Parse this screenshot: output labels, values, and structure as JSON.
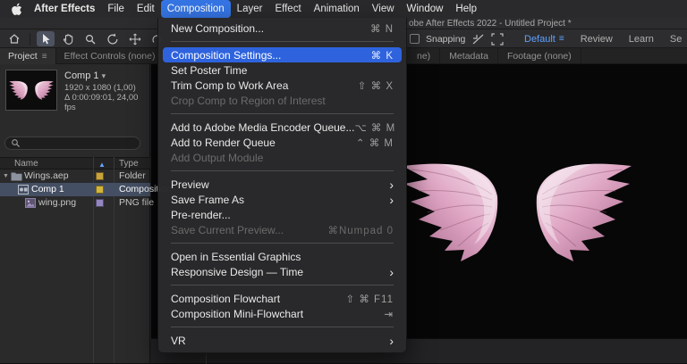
{
  "menubar": {
    "items": [
      {
        "label": "After Effects",
        "bold": true
      },
      {
        "label": "File"
      },
      {
        "label": "Edit"
      },
      {
        "label": "Composition",
        "active": true
      },
      {
        "label": "Layer"
      },
      {
        "label": "Effect"
      },
      {
        "label": "Animation"
      },
      {
        "label": "View"
      },
      {
        "label": "Window"
      },
      {
        "label": "Help"
      }
    ]
  },
  "titlebar": {
    "title": "obe After Effects 2022 - Untitled Project *"
  },
  "toolbar": {
    "snapping_label": "Snapping",
    "workspaces": [
      {
        "label": "Default",
        "active": true
      },
      {
        "label": "Review"
      },
      {
        "label": "Learn"
      },
      {
        "label": "Se"
      }
    ]
  },
  "composition_menu": {
    "items": [
      {
        "label": "New Composition...",
        "shortcut": "⌘ N"
      },
      {
        "type": "sep"
      },
      {
        "label": "Composition Settings...",
        "shortcut": "⌘ K",
        "state": "highlight"
      },
      {
        "label": "Set Poster Time"
      },
      {
        "label": "Trim Comp to Work Area",
        "shortcut": "⇧ ⌘ X"
      },
      {
        "label": "Crop Comp to Region of Interest",
        "state": "disabled"
      },
      {
        "type": "sep"
      },
      {
        "label": "Add to Adobe Media Encoder Queue...",
        "shortcut": "⌥ ⌘ M"
      },
      {
        "label": "Add to Render Queue",
        "shortcut": "⌃ ⌘ M"
      },
      {
        "label": "Add Output Module",
        "state": "disabled"
      },
      {
        "type": "sep"
      },
      {
        "label": "Preview",
        "submenu": true
      },
      {
        "label": "Save Frame As",
        "submenu": true
      },
      {
        "label": "Pre-render..."
      },
      {
        "label": "Save Current Preview...",
        "shortcut": "⌘Numpad 0",
        "state": "disabled"
      },
      {
        "type": "sep"
      },
      {
        "label": "Open in Essential Graphics"
      },
      {
        "label": "Responsive Design — Time",
        "submenu": true
      },
      {
        "type": "sep"
      },
      {
        "label": "Composition Flowchart",
        "shortcut": "⇧ ⌘ F11"
      },
      {
        "label": "Composition Mini-Flowchart",
        "shortcut": "⇥"
      },
      {
        "type": "sep"
      },
      {
        "label": "VR",
        "submenu": true
      }
    ]
  },
  "panel_tabs": {
    "left": [
      {
        "label": "Project",
        "active": true
      },
      {
        "label": "Effect Controls (none)",
        "active": false
      }
    ],
    "right": [
      {
        "label": "ne)"
      },
      {
        "label": "Metadata"
      },
      {
        "label": "Footage (none)"
      }
    ]
  },
  "project": {
    "comp_name": "Comp 1",
    "comp_resolution": "1920 x 1080 (1,00)",
    "comp_duration": "Δ 0:00:09:01, 24,00 fps",
    "columns": [
      "Name",
      "Type"
    ],
    "rows": [
      {
        "name": "Wings.aep",
        "type": "Folder",
        "icon": "folder",
        "label_color": "#c9a33b",
        "indent": 0,
        "expanded": true
      },
      {
        "name": "Comp 1",
        "type": "Composition",
        "icon": "composition",
        "label_color": "#d2b53d",
        "indent": 1,
        "selected": true
      },
      {
        "name": "wing.png",
        "type": "PNG file",
        "icon": "png",
        "label_color": "#9486c0",
        "indent": 2
      }
    ]
  },
  "icons": {
    "disclosure": "▼",
    "dropdown": "▾",
    "sort_asc": "▲",
    "submenu_arrow": "›",
    "panel_menu": "≡",
    "workspace_menu": "≡"
  },
  "colors": {
    "menu-highlight": "#2e63dd",
    "menubar-highlight": "#3575e4",
    "workspace-active": "#5ea0ff",
    "selected-row": "#454f63",
    "wing-pink": "#dfa6c4"
  }
}
